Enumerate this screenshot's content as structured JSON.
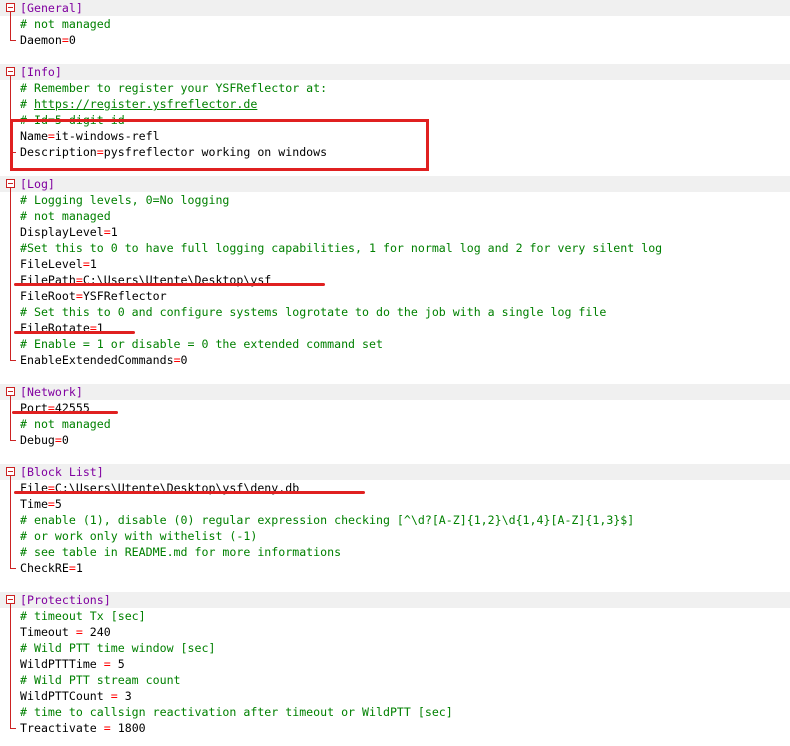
{
  "colors": {
    "section": "#8000a0",
    "comment": "#008000",
    "equals": "#ff0000",
    "annotation": "#e02020",
    "section_bg": "#f0f0f0",
    "fold_marker": "#cc2222"
  },
  "editor": {
    "lines": [
      {
        "kind": "section",
        "text": "[General]"
      },
      {
        "kind": "comment",
        "text": "# not managed"
      },
      {
        "kind": "kv",
        "key": "Daemon",
        "sep": "=",
        "value": "0"
      },
      {
        "kind": "blank"
      },
      {
        "kind": "section",
        "text": "[Info]"
      },
      {
        "kind": "comment",
        "text": "# Remember to register your YSFReflector at:"
      },
      {
        "kind": "link",
        "prefix": "# ",
        "text": "https://register.ysfreflector.de"
      },
      {
        "kind": "comment",
        "text": "# Id=5 digit id"
      },
      {
        "kind": "kv",
        "key": "Name",
        "sep": "=",
        "value": "it-windows-refl"
      },
      {
        "kind": "kv",
        "key": "Description",
        "sep": "=",
        "value": "pysfreflector working on windows"
      },
      {
        "kind": "blank"
      },
      {
        "kind": "section",
        "text": "[Log]"
      },
      {
        "kind": "comment",
        "text": "# Logging levels, 0=No logging"
      },
      {
        "kind": "comment",
        "text": "# not managed"
      },
      {
        "kind": "kv",
        "key": "DisplayLevel",
        "sep": "=",
        "value": "1"
      },
      {
        "kind": "comment",
        "text": "#Set this to 0 to have full logging capabilities, 1 for normal log and 2 for very silent log"
      },
      {
        "kind": "kv",
        "key": "FileLevel",
        "sep": "=",
        "value": "1"
      },
      {
        "kind": "kv",
        "key": "FilePath",
        "sep": "=",
        "value": "C:\\Users\\Utente\\Desktop\\ysf"
      },
      {
        "kind": "kv",
        "key": "FileRoot",
        "sep": "=",
        "value": "YSFReflector"
      },
      {
        "kind": "comment",
        "text": "# Set this to 0 and configure systems logrotate to do the job with a single log file"
      },
      {
        "kind": "kv",
        "key": "FileRotate",
        "sep": "=",
        "value": "1"
      },
      {
        "kind": "comment",
        "text": "# Enable = 1 or disable = 0 the extended command set"
      },
      {
        "kind": "kv",
        "key": "EnableExtendedCommands",
        "sep": "=",
        "value": "0"
      },
      {
        "kind": "blank"
      },
      {
        "kind": "section",
        "text": "[Network]"
      },
      {
        "kind": "kv",
        "key": "Port",
        "sep": "=",
        "value": "42555"
      },
      {
        "kind": "comment",
        "text": "# not managed"
      },
      {
        "kind": "kv",
        "key": "Debug",
        "sep": "=",
        "value": "0"
      },
      {
        "kind": "blank"
      },
      {
        "kind": "section",
        "text": "[Block List]"
      },
      {
        "kind": "kv",
        "key": "File",
        "sep": "=",
        "value": "C:\\Users\\Utente\\Desktop\\ysf\\deny.db"
      },
      {
        "kind": "kv",
        "key": "Time",
        "sep": "=",
        "value": "5"
      },
      {
        "kind": "comment",
        "text": "# enable (1), disable (0) regular expression checking [^\\d?[A-Z]{1,2}\\d{1,4}[A-Z]{1,3}$]"
      },
      {
        "kind": "comment",
        "text": "# or work only with withelist (-1)"
      },
      {
        "kind": "comment",
        "text": "# see table in README.md for more informations"
      },
      {
        "kind": "kv",
        "key": "CheckRE",
        "sep": "=",
        "value": "1"
      },
      {
        "kind": "blank"
      },
      {
        "kind": "section",
        "text": "[Protections]"
      },
      {
        "kind": "comment",
        "text": "# timeout Tx [sec]"
      },
      {
        "kind": "kv",
        "key": "Timeout ",
        "sep": "=",
        "value": " 240"
      },
      {
        "kind": "comment",
        "text": "# Wild PTT time window [sec]"
      },
      {
        "kind": "kv",
        "key": "WildPTTTime ",
        "sep": "=",
        "value": " 5"
      },
      {
        "kind": "comment",
        "text": "# Wild PTT stream count"
      },
      {
        "kind": "kv",
        "key": "WildPTTCount ",
        "sep": "=",
        "value": " 3"
      },
      {
        "kind": "comment",
        "text": "# time to callsign reactivation after timeout or WildPTT [sec]"
      },
      {
        "kind": "kv",
        "key": "Treactivate ",
        "sep": "=",
        "value": " 1800"
      }
    ]
  }
}
